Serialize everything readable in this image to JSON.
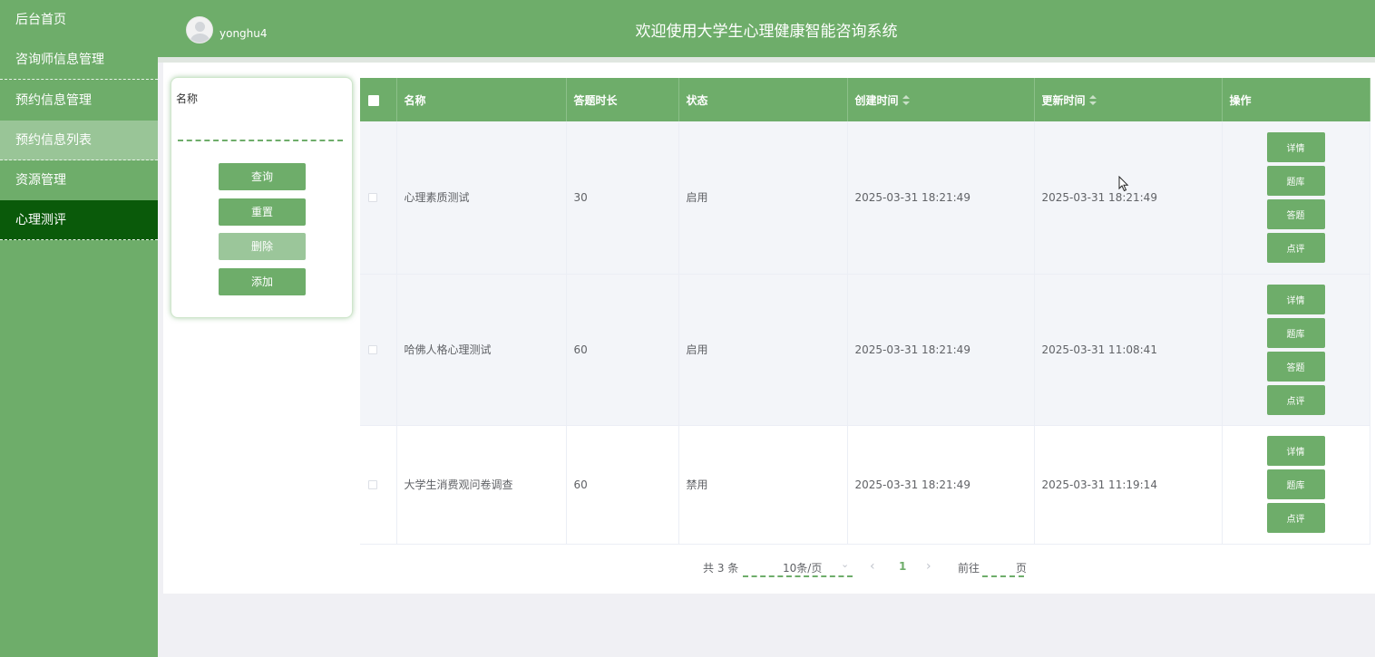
{
  "sidebar": {
    "items": [
      {
        "label": "后台首页"
      },
      {
        "label": "咨询师信息管理"
      },
      {
        "label": "预约信息管理"
      },
      {
        "label": "预约信息列表"
      },
      {
        "label": "资源管理"
      },
      {
        "label": "心理测评"
      }
    ]
  },
  "header": {
    "username": "yonghu4",
    "title": "欢迎使用大学生心理健康智能咨询系统"
  },
  "search": {
    "name_label": "名称",
    "name_value": "",
    "query_label": "查询",
    "reset_label": "重置",
    "delete_label": "删除",
    "add_label": "添加"
  },
  "table": {
    "columns": {
      "name": "名称",
      "duration": "答题时长",
      "status": "状态",
      "created": "创建时间",
      "updated": "更新时间",
      "ops": "操作"
    },
    "rows": [
      {
        "name": "心理素质测试",
        "duration": "30",
        "status": "启用",
        "created": "2025-03-31 18:21:49",
        "updated": "2025-03-31 18:21:49",
        "ops": [
          "详情",
          "题库",
          "答题",
          "点评"
        ]
      },
      {
        "name": "哈佛人格心理测试",
        "duration": "60",
        "status": "启用",
        "created": "2025-03-31 18:21:49",
        "updated": "2025-03-31 11:08:41",
        "ops": [
          "详情",
          "题库",
          "答题",
          "点评"
        ]
      },
      {
        "name": "大学生消费观问卷调查",
        "duration": "60",
        "status": "禁用",
        "created": "2025-03-31 18:21:49",
        "updated": "2025-03-31 11:19:14",
        "ops": [
          "详情",
          "题库",
          "点评"
        ]
      }
    ]
  },
  "pagination": {
    "total": "共 3 条",
    "page_size": "10条/页",
    "current": "1",
    "goto_prefix": "前往",
    "goto_suffix": "页",
    "prev_icon": "chevron-left-icon",
    "next_icon": "chevron-right-icon"
  },
  "colors": {
    "primary": "#6ead6a",
    "active_nav": "#0a5a0a",
    "light_nav": "#99c597"
  }
}
